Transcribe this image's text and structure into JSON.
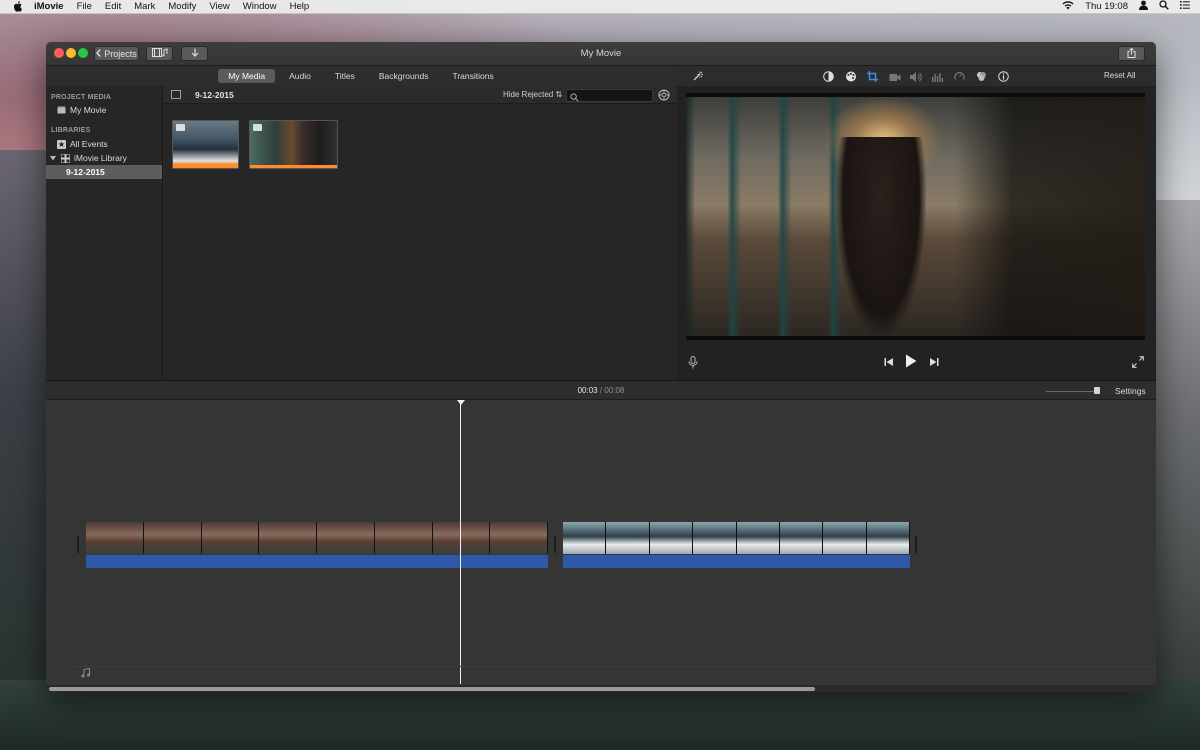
{
  "menubar": {
    "app_name": "iMovie",
    "items": [
      "File",
      "Edit",
      "Mark",
      "Modify",
      "View",
      "Window",
      "Help"
    ],
    "clock": "Thu 19:08"
  },
  "window": {
    "title": "My Movie",
    "projects_label": "Projects"
  },
  "browser": {
    "tabs": [
      {
        "label": "My Media",
        "active": true
      },
      {
        "label": "Audio",
        "active": false
      },
      {
        "label": "Titles",
        "active": false
      },
      {
        "label": "Backgrounds",
        "active": false
      },
      {
        "label": "Transitions",
        "active": false
      }
    ],
    "event_title": "9-12-2015",
    "filter_label": "Hide Rejected",
    "search_placeholder": ""
  },
  "sidebar": {
    "project_media_header": "PROJECT MEDIA",
    "project_item": "My Movie",
    "libraries_header": "LIBRARIES",
    "all_events": "All Events",
    "library": "iMovie Library",
    "selected_event": "9-12-2015"
  },
  "viewer": {
    "reset_label": "Reset All"
  },
  "timeline": {
    "current_time": "00:03",
    "separator": "/",
    "total_time": "00:08",
    "settings_label": "Settings"
  },
  "colors": {
    "accent_blue": "#2f58a8",
    "clip_orange": "#ff8b2b",
    "crop_icon_blue": "#3a8ee6"
  }
}
